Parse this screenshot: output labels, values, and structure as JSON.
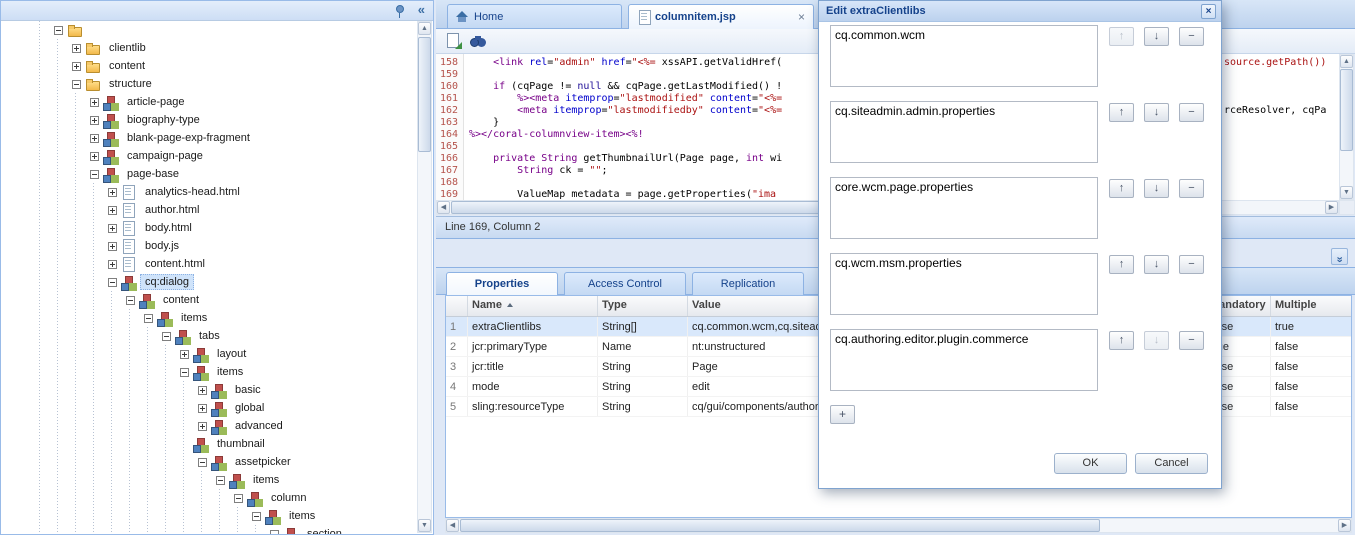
{
  "icons": {
    "close": "×",
    "collapse_left": "«",
    "expand_panel": "»",
    "scroll_up": "▲",
    "scroll_down": "▼",
    "scroll_left": "◀",
    "scroll_right": "▶",
    "up": "↑",
    "down": "↓",
    "remove": "−",
    "add": "+"
  },
  "colors": {
    "accent_border": "#99bbe8",
    "title_text": "#15428b",
    "selection": "#d9e8fb",
    "code_keyword": "#770088",
    "code_string": "#aa1111",
    "code_attribute": "#0000cc",
    "line_number_color": "#b5534c"
  },
  "left_panel": {
    "header": {
      "collapse_glyph": "«"
    },
    "tree": [
      {
        "label": "",
        "depth": 1,
        "expand": "-",
        "icon": "folder"
      },
      {
        "label": "clientlib",
        "depth": 2,
        "expand": "+",
        "icon": "folder"
      },
      {
        "label": "content",
        "depth": 2,
        "expand": "+",
        "icon": "folder"
      },
      {
        "label": "structure",
        "depth": 2,
        "expand": "-",
        "icon": "folder"
      },
      {
        "label": "article-page",
        "depth": 3,
        "expand": "+",
        "icon": "node"
      },
      {
        "label": "biography-type",
        "depth": 3,
        "expand": "+",
        "icon": "node"
      },
      {
        "label": "blank-page-exp-fragment",
        "depth": 3,
        "expand": "+",
        "icon": "node"
      },
      {
        "label": "campaign-page",
        "depth": 3,
        "expand": "+",
        "icon": "node"
      },
      {
        "label": "page-base",
        "depth": 3,
        "expand": "-",
        "icon": "node"
      },
      {
        "label": "analytics-head.html",
        "depth": 4,
        "expand": "+",
        "icon": "file"
      },
      {
        "label": "author.html",
        "depth": 4,
        "expand": "+",
        "icon": "file"
      },
      {
        "label": "body.html",
        "depth": 4,
        "expand": "+",
        "icon": "file"
      },
      {
        "label": "body.js",
        "depth": 4,
        "expand": "+",
        "icon": "file"
      },
      {
        "label": "content.html",
        "depth": 4,
        "expand": "+",
        "icon": "file"
      },
      {
        "label": "cq:dialog",
        "depth": 4,
        "expand": "-",
        "icon": "node",
        "selected": true
      },
      {
        "label": "content",
        "depth": 5,
        "expand": "-",
        "icon": "node"
      },
      {
        "label": "items",
        "depth": 6,
        "expand": "-",
        "icon": "node"
      },
      {
        "label": "tabs",
        "depth": 7,
        "expand": "-",
        "icon": "node"
      },
      {
        "label": "layout",
        "depth": 8,
        "expand": "+",
        "icon": "node"
      },
      {
        "label": "items",
        "depth": 8,
        "expand": "-",
        "icon": "node"
      },
      {
        "label": "basic",
        "depth": 9,
        "expand": "+",
        "icon": "node"
      },
      {
        "label": "global",
        "depth": 9,
        "expand": "+",
        "icon": "node"
      },
      {
        "label": "advanced",
        "depth": 9,
        "expand": "+",
        "icon": "node"
      },
      {
        "label": "thumbnail",
        "depth": 9,
        "expand": null,
        "icon": "node"
      },
      {
        "label": "assetpicker",
        "depth": 9,
        "expand": "-",
        "icon": "node"
      },
      {
        "label": "items",
        "depth": 10,
        "expand": "-",
        "icon": "node"
      },
      {
        "label": "column",
        "depth": 11,
        "expand": "-",
        "icon": "node"
      },
      {
        "label": "items",
        "depth": 12,
        "expand": "-",
        "icon": "node"
      },
      {
        "label": "section",
        "depth": 13,
        "expand": "-",
        "icon": "node"
      }
    ]
  },
  "editor": {
    "tabs": [
      {
        "label": "Home"
      },
      {
        "label": "columnitem.jsp",
        "active": true,
        "closable": true
      }
    ],
    "status": "Line 169, Column 2",
    "lines": [
      {
        "no": 158,
        "tokens": [
          [
            "pl",
            "    "
          ],
          [
            "tag",
            "<link"
          ],
          [
            "attr",
            " rel"
          ],
          [
            "pl",
            "="
          ],
          [
            "str",
            "\"admin\""
          ],
          [
            "attr",
            " href"
          ],
          [
            "pl",
            "="
          ],
          [
            "str",
            "\"<%="
          ],
          [
            "pl",
            " xssAPI.getValidHref("
          ]
        ]
      },
      {
        "no": 159,
        "tokens": []
      },
      {
        "no": 160,
        "tokens": [
          [
            "pl",
            "    "
          ],
          [
            "kw",
            "if"
          ],
          [
            "pl",
            " (cqPage != "
          ],
          [
            "atom",
            "null"
          ],
          [
            "pl",
            " && cqPage.getLastModified() !"
          ]
        ]
      },
      {
        "no": 161,
        "tokens": [
          [
            "pl",
            "        "
          ],
          [
            "tag",
            "%>"
          ],
          [
            "tag",
            "<meta"
          ],
          [
            "attr",
            " itemprop"
          ],
          [
            "pl",
            "="
          ],
          [
            "str",
            "\"lastmodified\""
          ],
          [
            "attr",
            " content"
          ],
          [
            "pl",
            "="
          ],
          [
            "str",
            "\"<%="
          ]
        ]
      },
      {
        "no": 162,
        "tokens": [
          [
            "pl",
            "        "
          ],
          [
            "tag",
            "<meta"
          ],
          [
            "attr",
            " itemprop"
          ],
          [
            "pl",
            "="
          ],
          [
            "str",
            "\"lastmodifiedby\""
          ],
          [
            "attr",
            " content"
          ],
          [
            "pl",
            "="
          ],
          [
            "str",
            "\"<%="
          ]
        ]
      },
      {
        "no": 163,
        "tokens": [
          [
            "pl",
            "    }"
          ]
        ]
      },
      {
        "no": 164,
        "tokens": [
          [
            "tag",
            "%></coral-columnview-item><%!"
          ]
        ]
      },
      {
        "no": 165,
        "tokens": []
      },
      {
        "no": 166,
        "tokens": [
          [
            "pl",
            "    "
          ],
          [
            "kw",
            "private"
          ],
          [
            "pl",
            " "
          ],
          [
            "kw",
            "String"
          ],
          [
            "pl",
            " getThumbnailUrl(Page page, "
          ],
          [
            "kw",
            "int"
          ],
          [
            "pl",
            " wi"
          ]
        ]
      },
      {
        "no": 167,
        "tokens": [
          [
            "pl",
            "        "
          ],
          [
            "kw",
            "String"
          ],
          [
            "pl",
            " ck = "
          ],
          [
            "str",
            "\"\""
          ],
          [
            "pl",
            ";"
          ]
        ]
      },
      {
        "no": 168,
        "tokens": []
      },
      {
        "no": 169,
        "tokens": [
          [
            "pl",
            "        ValueMap metadata = page.getProperties("
          ],
          [
            "str",
            "\"ima"
          ]
        ]
      }
    ],
    "right_fragments": [
      {
        "row": 0,
        "tokens": [
          [
            "str",
            "source.getPath())"
          ]
        ]
      },
      {
        "row": 4,
        "tokens": [
          [
            "pl",
            "rceResolver, cqPa"
          ]
        ]
      }
    ]
  },
  "properties_panel": {
    "tabs": [
      "Properties",
      "Access Control",
      "Replication"
    ],
    "columns": [
      "",
      "Name",
      "Type",
      "Value",
      "Mandatory",
      "Multiple"
    ],
    "rows": [
      {
        "n": 1,
        "name": "extraClientlibs",
        "type": "String[]",
        "value": "cq.common.wcm,cq.siteadmin.admin.properties,core.wcm.page.properties,cq.wcm.msm.properties,cq.authoring.editor.plugin.commerce",
        "mandatory": "false",
        "multiple": "true",
        "selected": true
      },
      {
        "n": 2,
        "name": "jcr:primaryType",
        "type": "Name",
        "value": "nt:unstructured",
        "mandatory": "true",
        "multiple": "false"
      },
      {
        "n": 3,
        "name": "jcr:title",
        "type": "String",
        "value": "Page",
        "mandatory": "false",
        "multiple": "false"
      },
      {
        "n": 4,
        "name": "mode",
        "type": "String",
        "value": "edit",
        "mandatory": "false",
        "multiple": "false"
      },
      {
        "n": 5,
        "name": "sling:resourceType",
        "type": "String",
        "value": "cq/gui/components/authoring/dialog",
        "mandatory": "false",
        "multiple": "false"
      }
    ]
  },
  "dialog": {
    "title": "Edit extraClientlibs",
    "items": [
      {
        "value": "cq.common.wcm",
        "up_disabled": true
      },
      {
        "value": "cq.siteadmin.admin.properties"
      },
      {
        "value": "core.wcm.page.properties"
      },
      {
        "value": "cq.wcm.msm.properties"
      },
      {
        "value": "cq.authoring.editor.plugin.commerce",
        "down_disabled": true
      }
    ],
    "ok_label": "OK",
    "cancel_label": "Cancel"
  }
}
